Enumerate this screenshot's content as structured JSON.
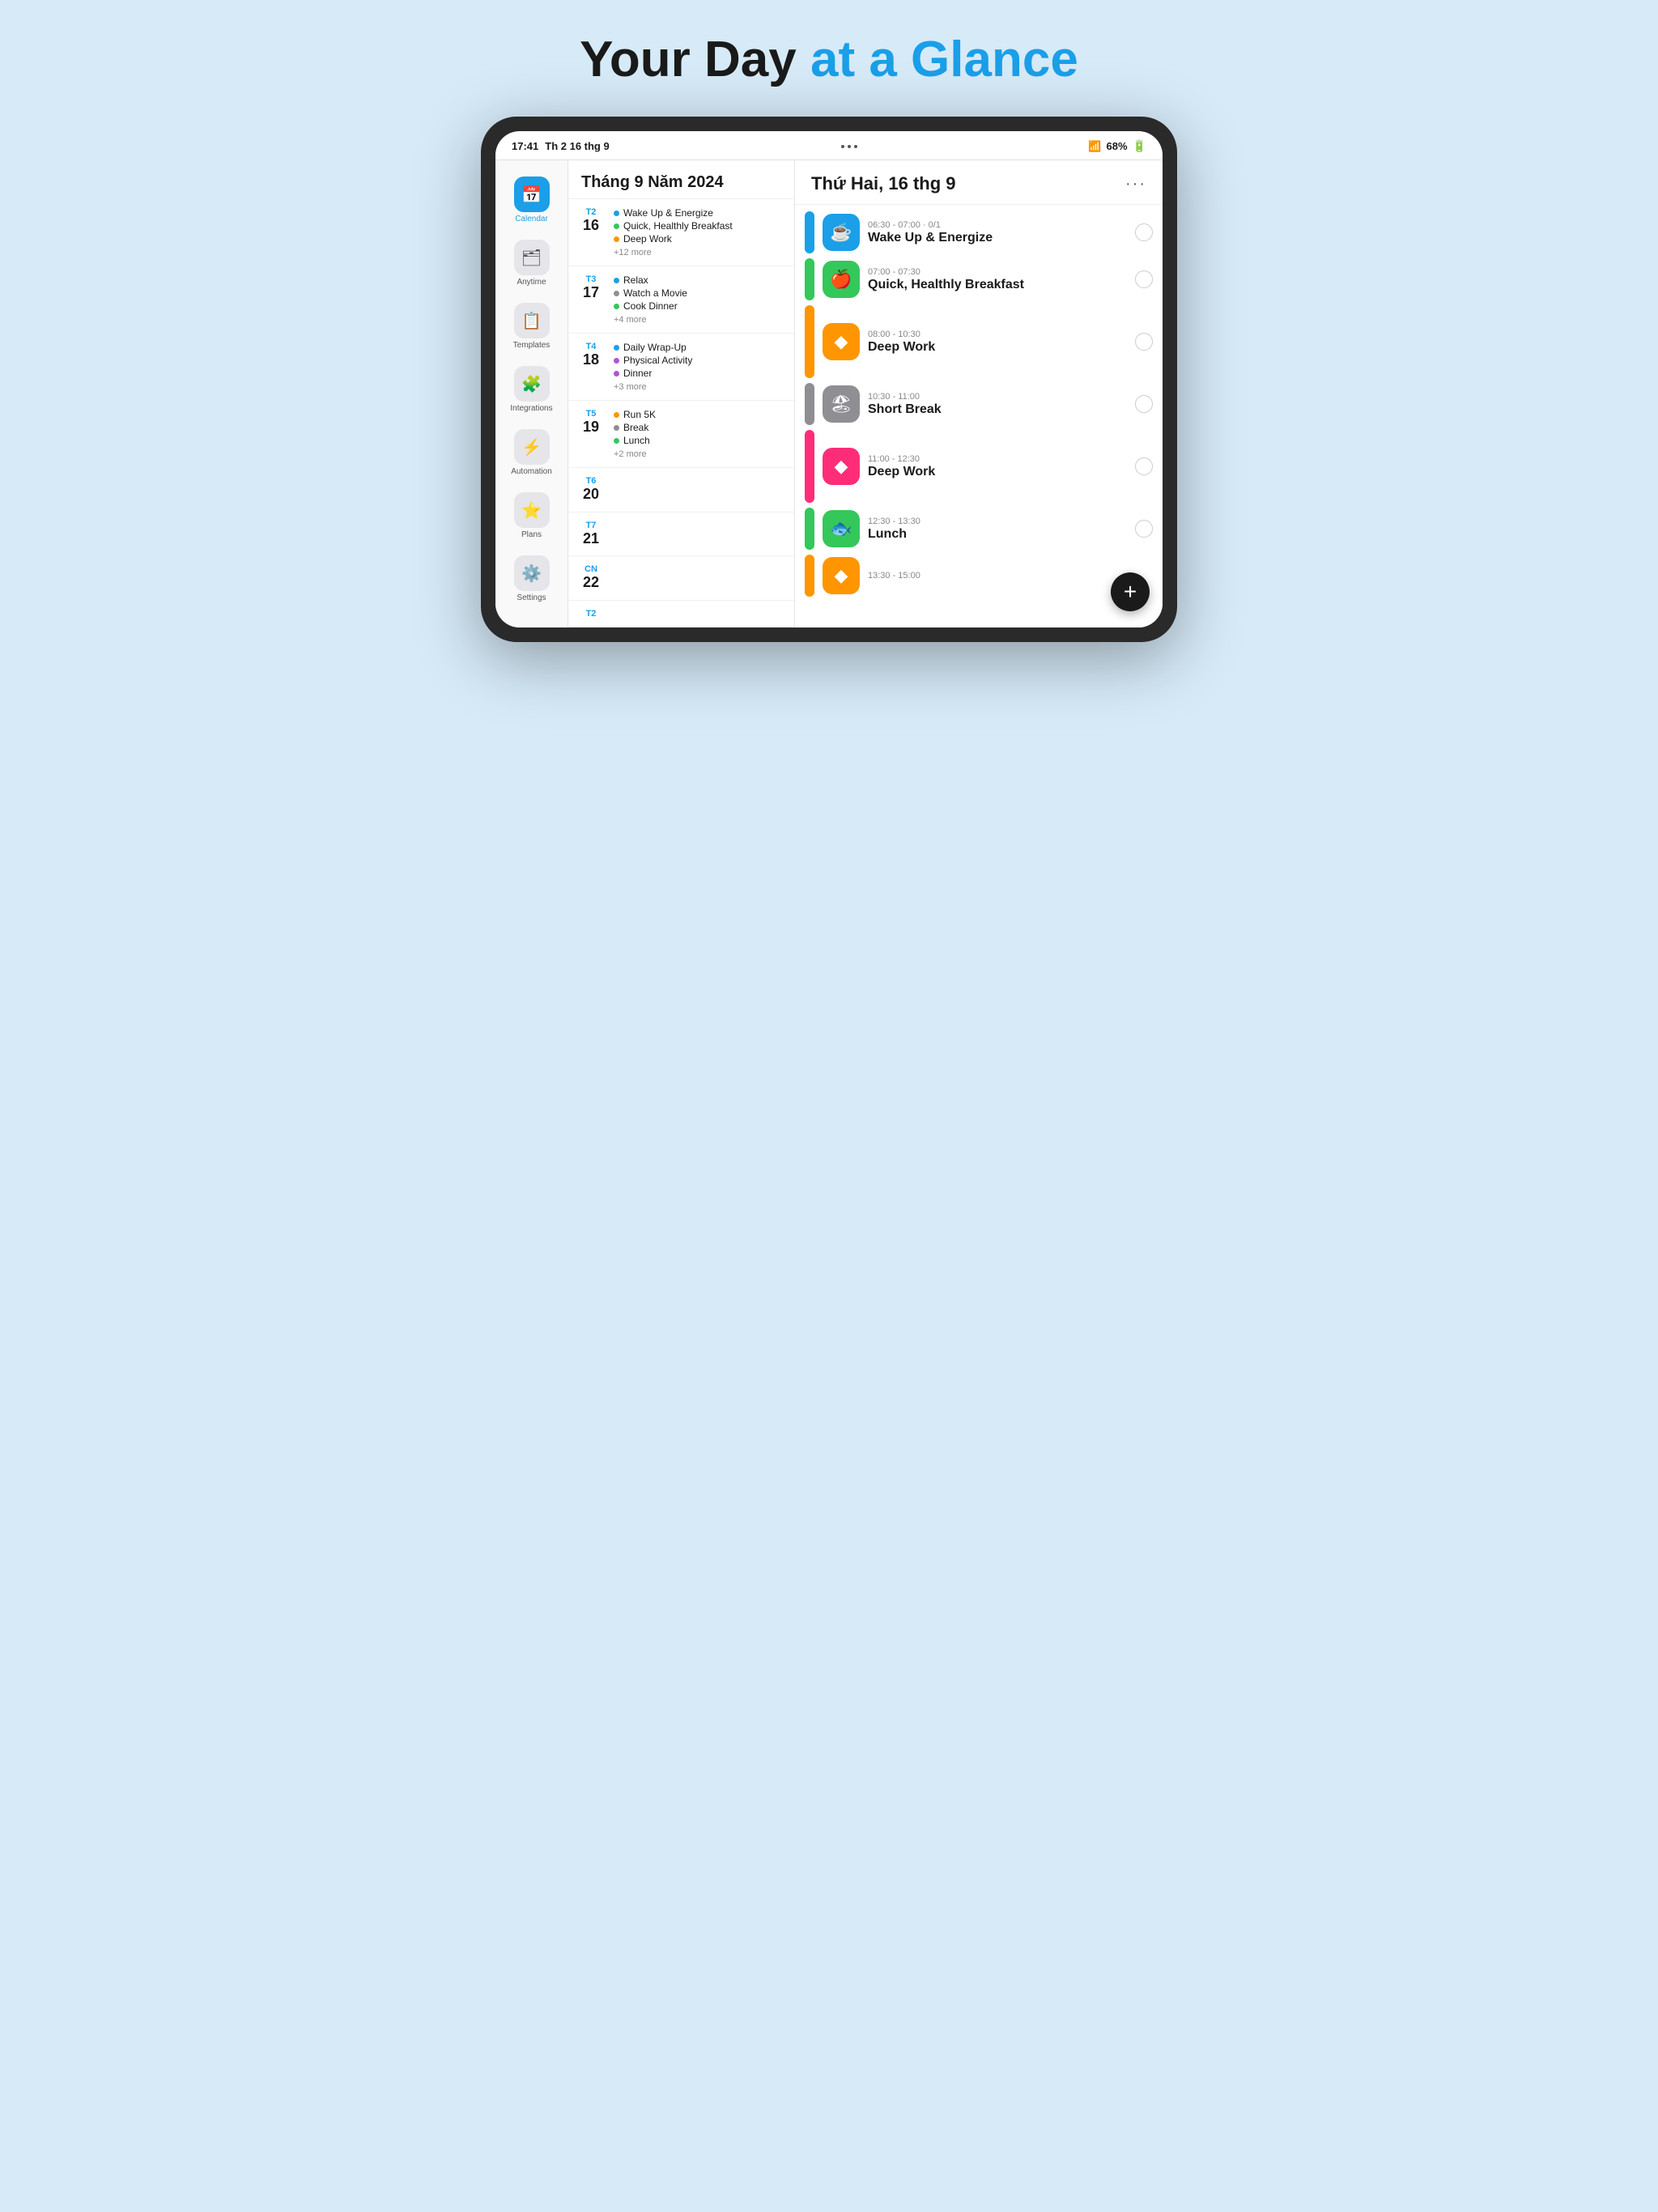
{
  "headline": {
    "part1": "Your Day ",
    "part2": "at a Glance"
  },
  "status_bar": {
    "time": "17:41",
    "date": "Th 2 16 thg 9",
    "battery": "68%"
  },
  "sidebar": {
    "items": [
      {
        "id": "calendar",
        "label": "Calendar",
        "icon": "📅",
        "active": true
      },
      {
        "id": "anytime",
        "label": "Anytime",
        "icon": "🗂",
        "active": false
      },
      {
        "id": "templates",
        "label": "Templates",
        "icon": "📋",
        "active": false
      },
      {
        "id": "integrations",
        "label": "Integrations",
        "icon": "🧩",
        "active": false
      },
      {
        "id": "automation",
        "label": "Automation",
        "icon": "⚡",
        "active": false
      },
      {
        "id": "plans",
        "label": "Plans",
        "icon": "⭐",
        "active": false
      },
      {
        "id": "settings",
        "label": "Settings",
        "icon": "⚙️",
        "active": false
      }
    ]
  },
  "calendar_panel": {
    "title": "Tháng 9 Năm 2024",
    "rows": [
      {
        "day_label": "T2",
        "day_num": "16",
        "events": [
          {
            "name": "Wake Up & Energize",
            "color": "blue"
          },
          {
            "name": "Quick, Healthly Breakfast",
            "color": "green"
          },
          {
            "name": "Deep Work",
            "color": "orange"
          }
        ],
        "more": "+12 more"
      },
      {
        "day_label": "T3",
        "day_num": "17",
        "events": [
          {
            "name": "Relax",
            "color": "blue"
          },
          {
            "name": "Watch a Movie",
            "color": "gray"
          },
          {
            "name": "Cook Dinner",
            "color": "green"
          }
        ],
        "more": "+4 more"
      },
      {
        "day_label": "T4",
        "day_num": "18",
        "events": [
          {
            "name": "Daily Wrap-Up",
            "color": "blue"
          },
          {
            "name": "Physical Activity",
            "color": "purple"
          },
          {
            "name": "Dinner",
            "color": "purple"
          }
        ],
        "more": "+3 more"
      },
      {
        "day_label": "T5",
        "day_num": "19",
        "events": [
          {
            "name": "Run 5K",
            "color": "orange"
          },
          {
            "name": "Break",
            "color": "gray"
          },
          {
            "name": "Lunch",
            "color": "green"
          }
        ],
        "more": "+2 more"
      },
      {
        "day_label": "T6",
        "day_num": "20",
        "events": [],
        "more": ""
      },
      {
        "day_label": "T7",
        "day_num": "21",
        "events": [],
        "more": ""
      },
      {
        "day_label": "CN",
        "day_num": "22",
        "events": [],
        "more": ""
      },
      {
        "day_label": "T2",
        "day_num": "",
        "events": [],
        "more": ""
      }
    ]
  },
  "day_panel": {
    "title": "Thứ Hai, 16 thg 9",
    "events": [
      {
        "time": "06:30 - 07:00 · 0/1",
        "name": "Wake Up & Energize",
        "bar_color": "blue",
        "icon_color": "blue",
        "icon": "☕"
      },
      {
        "time": "07:00 - 07:30",
        "name": "Quick, Healthly Breakfast",
        "bar_color": "green",
        "icon_color": "green",
        "icon": "🍎"
      },
      {
        "time": "08:00 - 10:30",
        "name": "Deep Work",
        "bar_color": "orange",
        "icon_color": "orange",
        "icon": "◆",
        "tall": true
      },
      {
        "time": "10:30 - 11:00",
        "name": "Short Break",
        "bar_color": "gray",
        "icon_color": "gray",
        "icon": "🏖"
      },
      {
        "time": "11:00 - 12:30",
        "name": "Deep Work",
        "bar_color": "pink",
        "icon_color": "pink",
        "icon": "◆",
        "tall": true
      },
      {
        "time": "12:30 - 13:30",
        "name": "Lunch",
        "bar_color": "green",
        "icon_color": "green",
        "icon": "🐟"
      },
      {
        "time": "13:30 - 15:00",
        "name": "",
        "bar_color": "orange",
        "icon_color": "orange",
        "icon": "◆",
        "partial": true
      }
    ],
    "fab_label": "+"
  }
}
